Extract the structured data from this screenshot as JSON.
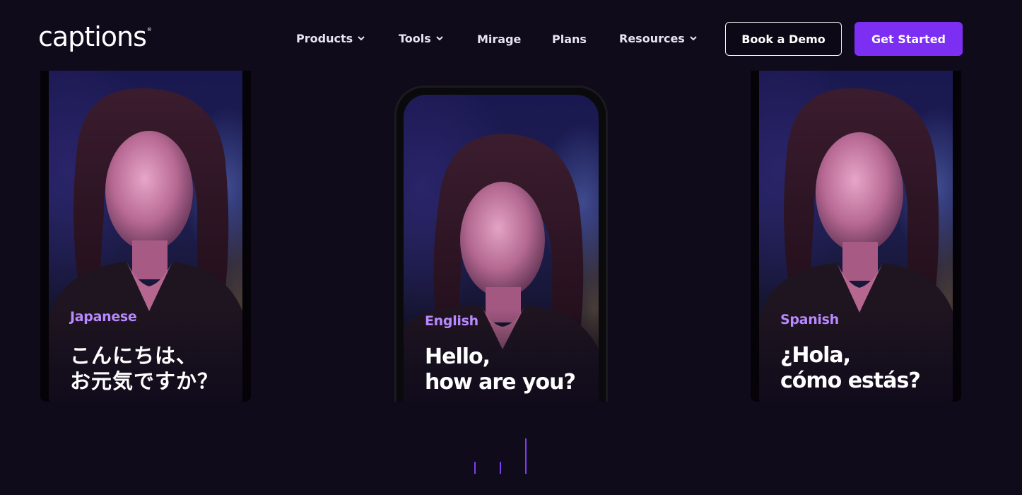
{
  "header": {
    "logo_text": "captions",
    "logo_mark": "®",
    "nav": [
      {
        "label": "Products",
        "has_dropdown": true
      },
      {
        "label": "Tools",
        "has_dropdown": true
      },
      {
        "label": "Mirage",
        "has_dropdown": false
      },
      {
        "label": "Plans",
        "has_dropdown": false
      },
      {
        "label": "Resources",
        "has_dropdown": true
      }
    ],
    "book_demo_label": "Book a Demo",
    "get_started_label": "Get Started"
  },
  "carousel": {
    "cards": [
      {
        "language": "Japanese",
        "caption": "こんにちは、\nお元気ですか？"
      },
      {
        "language": "English",
        "caption": "Hello,\nhow are you?"
      },
      {
        "language": "Spanish",
        "caption": "¿Hola,\ncómo estás?"
      }
    ],
    "pages": 3,
    "active_page": 3
  },
  "colors": {
    "background": "#100b1b",
    "accent": "#7c2ff2",
    "language_label": "#b889ff"
  }
}
